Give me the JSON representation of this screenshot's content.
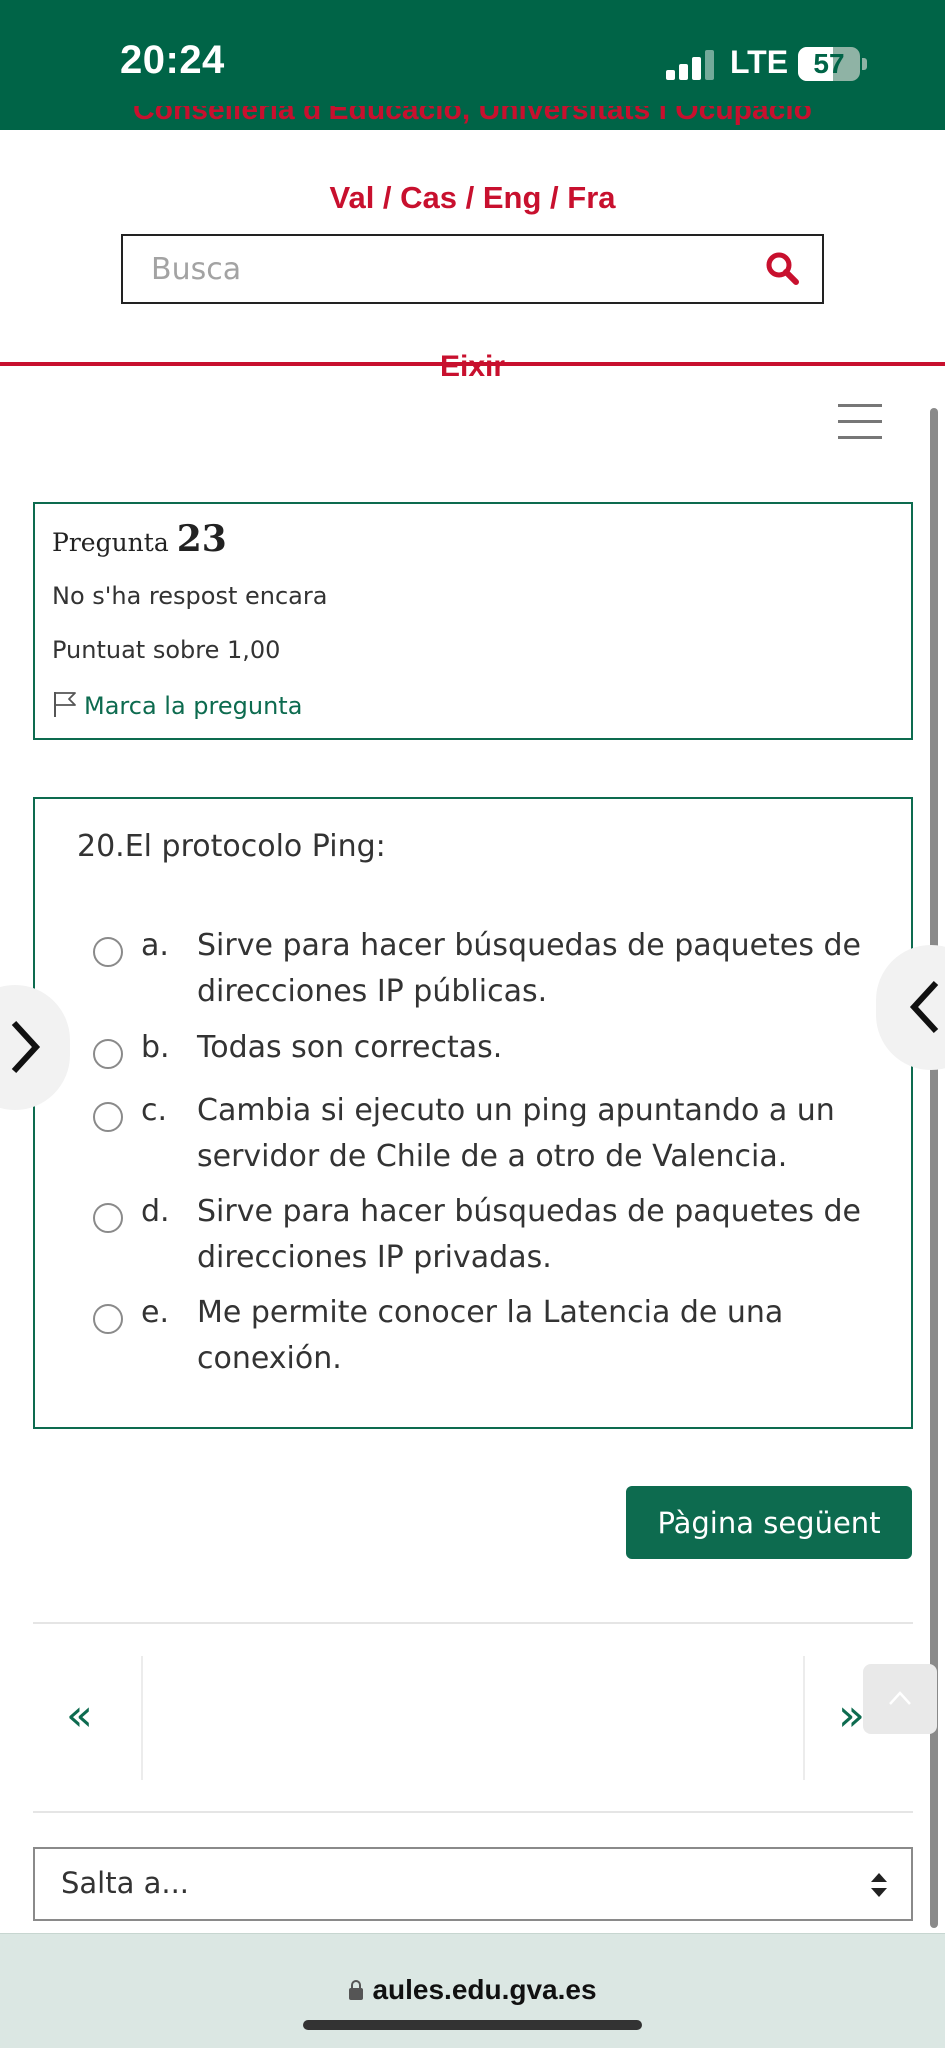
{
  "status_bar": {
    "time": "20:24",
    "network": "LTE",
    "battery": "57",
    "battery_level": 0.57
  },
  "header": {
    "org_title": "Conselleria d'Educació, Universitats i Ocupació",
    "languages": "Val / Cas / Eng / Fra",
    "search_placeholder": "Busca",
    "logout": "Eixir"
  },
  "question_info": {
    "label": "Pregunta",
    "number": "23",
    "status": "No s'ha respost encara",
    "grade": "Puntuat sobre 1,00",
    "flag_label": "Marca la pregunta"
  },
  "question": {
    "text": "20.El protocolo Ping:",
    "answers": [
      {
        "letter": "a.",
        "text": "Sirve para hacer búsquedas de paquetes de direcciones IP públicas."
      },
      {
        "letter": "b.",
        "text": "Todas son correctas."
      },
      {
        "letter": "c.",
        "text": "Cambia si ejecuto un ping apuntando a un servidor de Chile de a otro de Valencia."
      },
      {
        "letter": "d.",
        "text": "Sirve para hacer búsquedas de paquetes de direcciones IP privadas."
      },
      {
        "letter": "e.",
        "text": "Me permite conocer la Latencia de una conexión."
      }
    ]
  },
  "navigation": {
    "next_page": "Pàgina següent",
    "prev_symbol": "«",
    "next_symbol": "»",
    "jump_to": "Salta a..."
  },
  "browser": {
    "url": "aules.edu.gva.es"
  },
  "colors": {
    "brand_green": "#006447",
    "accent_red": "#c8102e"
  },
  "icons": {
    "search": "search-icon",
    "flag": "flag-icon",
    "menu": "hamburger-menu-icon",
    "lock": "lock-icon"
  }
}
